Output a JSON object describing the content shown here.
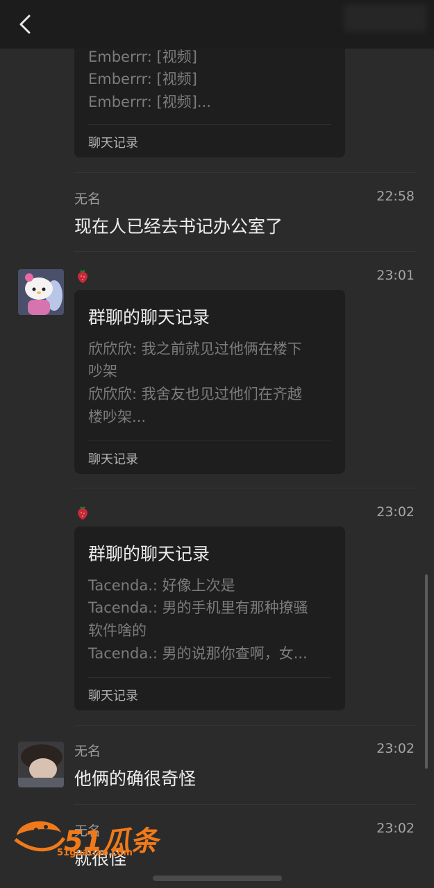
{
  "header": {
    "back_icon": "chevron-left-icon"
  },
  "messages": {
    "m0": {
      "card_lines": [
        "Emberrr: [视频]",
        "Emberrr: [视频]",
        "Emberrr: [视频]..."
      ],
      "card_footer": "聊天记录"
    },
    "m1": {
      "name": "无名",
      "time": "22:58",
      "text": "现在人已经去书记办公室了"
    },
    "m2": {
      "time": "23:01",
      "card_title": "群聊的聊天记录",
      "card_lines": [
        "欣欣欣: 我之前就见过他俩在楼下",
        "吵架",
        "欣欣欣: 我舍友也见过他们在齐越",
        "楼吵架..."
      ],
      "card_footer": "聊天记录"
    },
    "m3": {
      "time": "23:02",
      "card_title": "群聊的聊天记录",
      "card_lines": [
        "Tacenda.: 好像上次是",
        "Tacenda.: 男的手机里有那种撩骚",
        "软件啥的",
        "Tacenda.: 男的说那你查啊，女..."
      ],
      "card_footer": "聊天记录"
    },
    "m4": {
      "name": "无名",
      "time": "23:02",
      "text": "他俩的确很奇怪"
    },
    "m5": {
      "name": "无名",
      "time": "23:02",
      "text": "就很怪"
    }
  },
  "watermark": {
    "logo": "51瓜条",
    "sub": "51guatiao.com"
  },
  "colors": {
    "background": "#2b2b2b",
    "card": "#1e1e1e",
    "watermark": "#f07a1a"
  }
}
